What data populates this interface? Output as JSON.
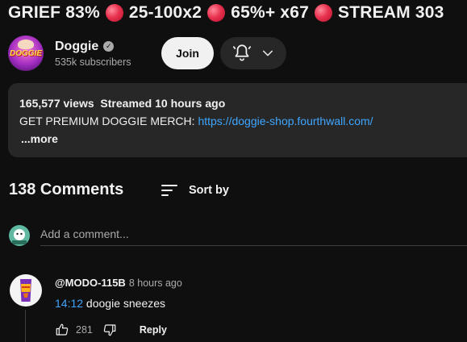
{
  "video": {
    "title_parts": [
      "GRIEF 83%",
      "25-100x2",
      "65%+ x67",
      "STREAM 303"
    ]
  },
  "channel": {
    "name": "Doggie",
    "subscribers": "535k subscribers",
    "avatar_text": "DOGGIE",
    "join_label": "Join"
  },
  "description": {
    "views": "165,577 views",
    "streamed": "Streamed 10 hours ago",
    "line_prefix": "GET PREMIUM DOGGIE MERCH: ",
    "link": "https://doggie-shop.fourthwall.com/",
    "more_label": "...more"
  },
  "comments": {
    "count_label": "138 Comments",
    "sort_label": "Sort by",
    "add_placeholder": "Add a comment...",
    "items": [
      {
        "author": "@MODO-115B",
        "time": "8 hours ago",
        "timestamp": "14:12",
        "text": " doogie sneezes",
        "likes": "281",
        "reply_label": "Reply"
      }
    ]
  },
  "colors": {
    "background": "#0f0f0f",
    "surface": "#272727",
    "link": "#3ea6ff",
    "dot": "#e8324f"
  }
}
